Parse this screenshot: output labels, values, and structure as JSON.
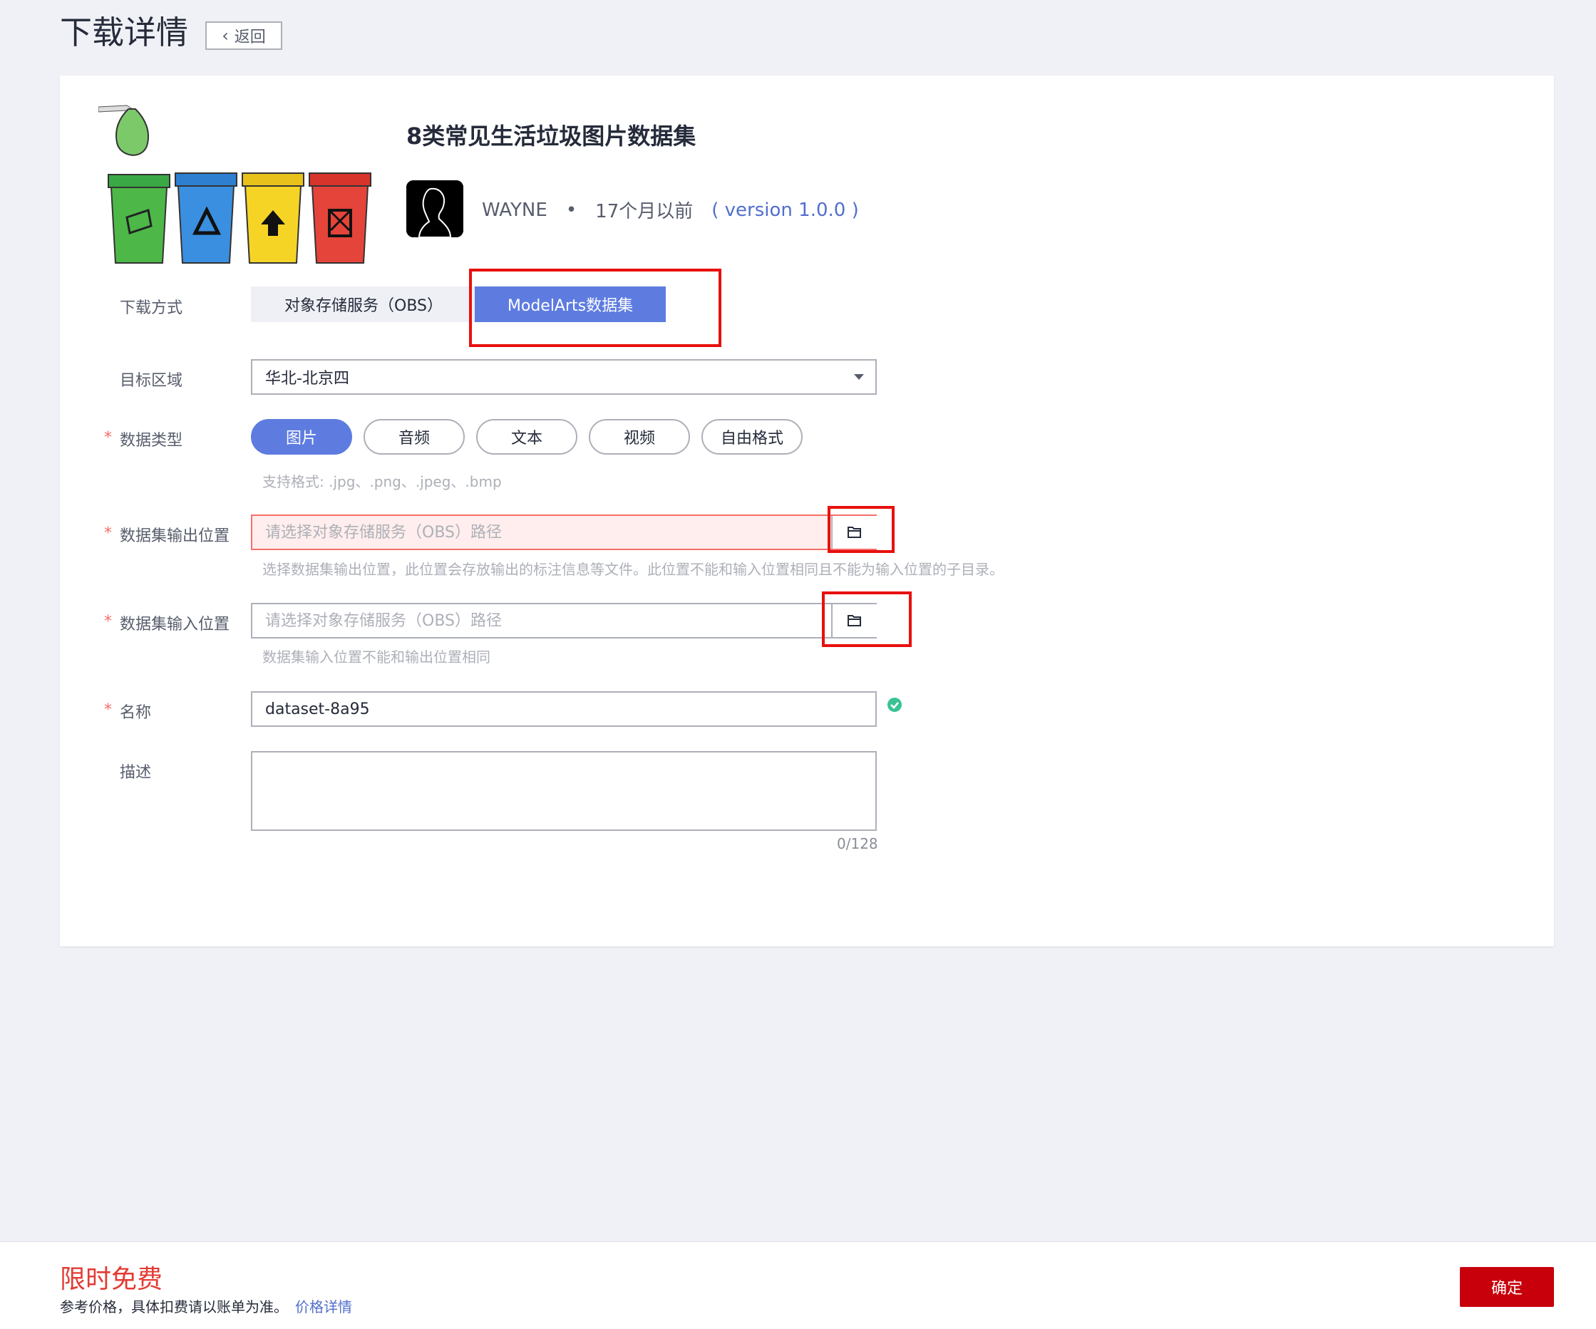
{
  "header": {
    "title": "下载详情",
    "back_label": "返回"
  },
  "dataset": {
    "title": "8类常见生活垃圾图片数据集",
    "author": "WAYNE",
    "separator": "•",
    "time": "17个月以前",
    "version": "( version 1.0.0 )"
  },
  "form": {
    "download_method": {
      "label": "下载方式",
      "options": [
        "对象存储服务（OBS）",
        "ModelArts数据集"
      ],
      "selected": "ModelArts数据集"
    },
    "target_region": {
      "label": "目标区域",
      "value": "华北-北京四"
    },
    "data_type": {
      "label": "数据类型",
      "options": [
        "图片",
        "音频",
        "文本",
        "视频",
        "自由格式"
      ],
      "selected": "图片",
      "hint": "支持格式: .jpg、.png、.jpeg、.bmp"
    },
    "output_location": {
      "label": "数据集输出位置",
      "placeholder": "请选择对象存储服务（OBS）路径",
      "hint": "选择数据集输出位置，此位置会存放输出的标注信息等文件。此位置不能和输入位置相同且不能为输入位置的子目录。"
    },
    "input_location": {
      "label": "数据集输入位置",
      "placeholder": "请选择对象存储服务（OBS）路径",
      "hint": "数据集输入位置不能和输出位置相同"
    },
    "name": {
      "label": "名称",
      "value": "dataset-8a95"
    },
    "description": {
      "label": "描述",
      "value": "",
      "counter": "0/128"
    }
  },
  "footer": {
    "free_label": "限时免费",
    "ref_text": "参考价格，具体扣费请以账单为准。",
    "price_link": "价格详情",
    "confirm_label": "确定"
  },
  "colors": {
    "accent": "#5e7ce0",
    "confirm": "#c7000b",
    "error": "#f66f6a",
    "highlight_box": "#e8100d",
    "valid": "#3ac295"
  },
  "icons": [
    "chevron-left-icon",
    "caret-down-icon",
    "folder-icon",
    "check-circle-icon"
  ]
}
